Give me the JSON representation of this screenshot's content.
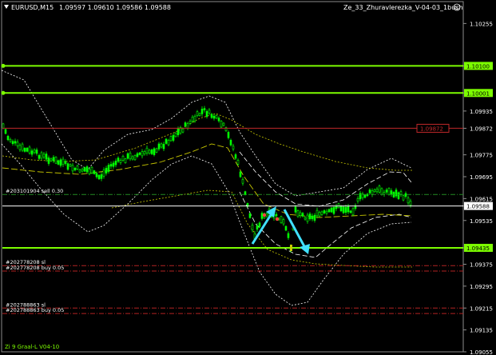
{
  "window": {
    "symbol_timeframe": "EURUSD,M15",
    "ohlc": "1.09597 1.09610 1.09586 1.09588",
    "expert": "Ze_33_Zhuravlerezka_V-04-03_1bush",
    "expert_icon": "smiley-icon",
    "indicator_label": "Zi 9 Graal-L V04-10"
  },
  "price_scale": {
    "ticks": [
      "1.10255",
      "1.10100",
      "1.10001",
      "1.09935",
      "1.09872",
      "1.09775",
      "1.09695",
      "1.09615",
      "1.09588",
      "1.09535",
      "1.09435",
      "1.09375",
      "1.09295",
      "1.09215",
      "1.09135",
      "1.09055"
    ],
    "ymax": 1.10335,
    "ymin": 1.09055
  },
  "levels": [
    {
      "price": 1.101,
      "label": "1.10100",
      "color": "#7cfc00",
      "kind": "green-line"
    },
    {
      "price": 1.10001,
      "label": "1.10001",
      "color": "#7cfc00",
      "kind": "green-line"
    },
    {
      "price": 1.09872,
      "label": "1.09872",
      "color": "#c0282a",
      "kind": "red-line"
    },
    {
      "price": 1.09588,
      "label": "1.09588",
      "color": "#ffffff",
      "kind": "current-price"
    },
    {
      "price": 1.09435,
      "label": "1.09435",
      "color": "#7cfc00",
      "kind": "green-line"
    }
  ],
  "orders": [
    {
      "price": 1.0963,
      "label": "#203101904 sell 0.30",
      "color": "#228b22"
    },
    {
      "price": 1.0937,
      "label": "#202778208 sl",
      "color": "#b22222"
    },
    {
      "price": 1.0935,
      "label": "#202778208 buy 0.05",
      "color": "#b22222"
    },
    {
      "price": 1.09215,
      "label": "#202788863 sl",
      "color": "#b22222"
    },
    {
      "price": 1.09195,
      "label": "#202788863 buy 0.05",
      "color": "#b22222"
    }
  ],
  "colors": {
    "background": "#000000",
    "bull_candle": "#00ff00",
    "bear_candle": "#00ff00",
    "band_white": "#ffffff",
    "band_yellow": "#c8c800",
    "arrow": "#40e0ff",
    "scale_text": "#ffffff"
  }
}
